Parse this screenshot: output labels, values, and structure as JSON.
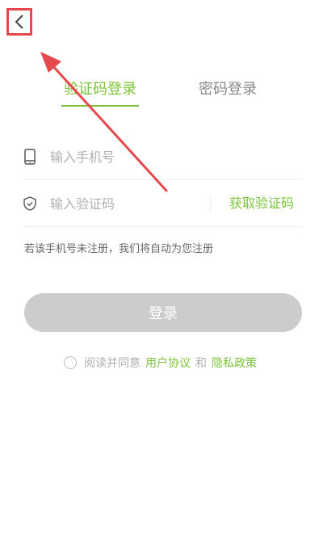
{
  "tabs": [
    {
      "label": "验证码登录",
      "active": true
    },
    {
      "label": "密码登录",
      "active": false
    }
  ],
  "phone": {
    "placeholder": "输入手机号",
    "icon": "phone-icon"
  },
  "code": {
    "placeholder": "输入验证码",
    "icon": "shield-icon",
    "get_code_label": "获取验证码"
  },
  "hint": "若该手机号未注册，我们将自动为您注册",
  "login_button": "登录",
  "agreement": {
    "prefix": "阅读并同意",
    "user_agreement": "用户协议",
    "and": "和",
    "privacy_policy": "隐私政策"
  },
  "colors": {
    "accent": "#7bc43a",
    "button_disabled": "#cccccc",
    "annotation": "#e5484d"
  }
}
